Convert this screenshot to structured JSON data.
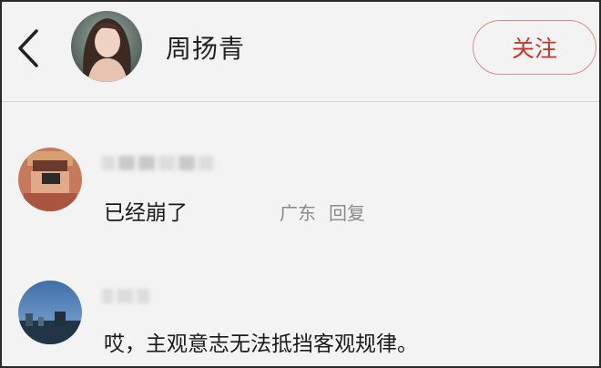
{
  "header": {
    "user_name": "周扬青",
    "follow_label": "关注"
  },
  "comments": [
    {
      "text": "已经崩了",
      "location": "广东",
      "reply_label": "回复"
    },
    {
      "text": "哎，主观意志无法抵挡客观规律。"
    }
  ],
  "colors": {
    "follow_accent": "#c9372c",
    "background": "#f3f3f3"
  },
  "icons": {
    "back": "chevron-left-icon"
  }
}
